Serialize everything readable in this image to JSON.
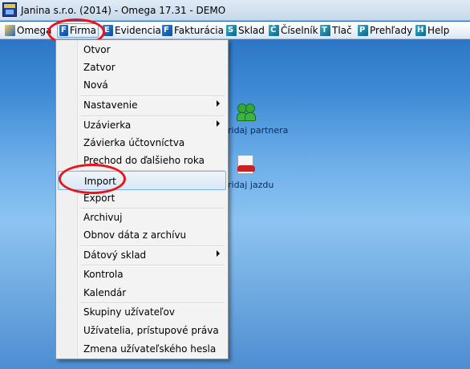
{
  "window": {
    "title": "Janina s.r.o. (2014) - Omega 17.31 - DEMO"
  },
  "menubar": [
    {
      "key": "omega",
      "label": "Omega",
      "icon": "omega-app-icon"
    },
    {
      "key": "firma",
      "label": "Firma",
      "icon": "firma-icon",
      "active": true
    },
    {
      "key": "evidencia",
      "label": "Evidencia",
      "icon": "evidencia-icon"
    },
    {
      "key": "fakturacia",
      "label": "Fakturácia",
      "icon": "fakturacia-icon"
    },
    {
      "key": "sklad",
      "label": "Sklad",
      "icon": "sklad-icon"
    },
    {
      "key": "ciselnik",
      "label": "Číselník",
      "icon": "ciselnik-icon"
    },
    {
      "key": "tlac",
      "label": "Tlač",
      "icon": "tlac-icon"
    },
    {
      "key": "prehlady",
      "label": "Prehľady",
      "icon": "prehlady-icon"
    },
    {
      "key": "help",
      "label": "Help",
      "icon": "help-icon"
    }
  ],
  "desktop": {
    "partner_label": "ridaj partnera",
    "jazda_label": "ridaj jazdu"
  },
  "dropdown": {
    "items": [
      {
        "label": "Otvor"
      },
      {
        "label": "Zatvor"
      },
      {
        "label": "Nová"
      },
      {
        "label": "Nastavenie",
        "submenu": true
      },
      {
        "label": "Uzávierka",
        "submenu": true
      },
      {
        "label": "Závierka účtovníctva"
      },
      {
        "label": "Prechod do ďalšieho roka"
      },
      {
        "label": "Import",
        "selected": true
      },
      {
        "label": "Export"
      },
      {
        "label": "Archivuj"
      },
      {
        "label": "Obnov dáta z archívu"
      },
      {
        "label": "Dátový sklad",
        "submenu": true
      },
      {
        "label": "Kontrola"
      },
      {
        "label": "Kalendár"
      },
      {
        "label": "Skupiny užívateľov"
      },
      {
        "label": "Užívatelia,  prístupové práva"
      },
      {
        "label": "Zmena užívateľského hesla"
      }
    ]
  },
  "colors": {
    "highlight_circle": "#e8141a",
    "selection_border": "#7eb4ea"
  }
}
